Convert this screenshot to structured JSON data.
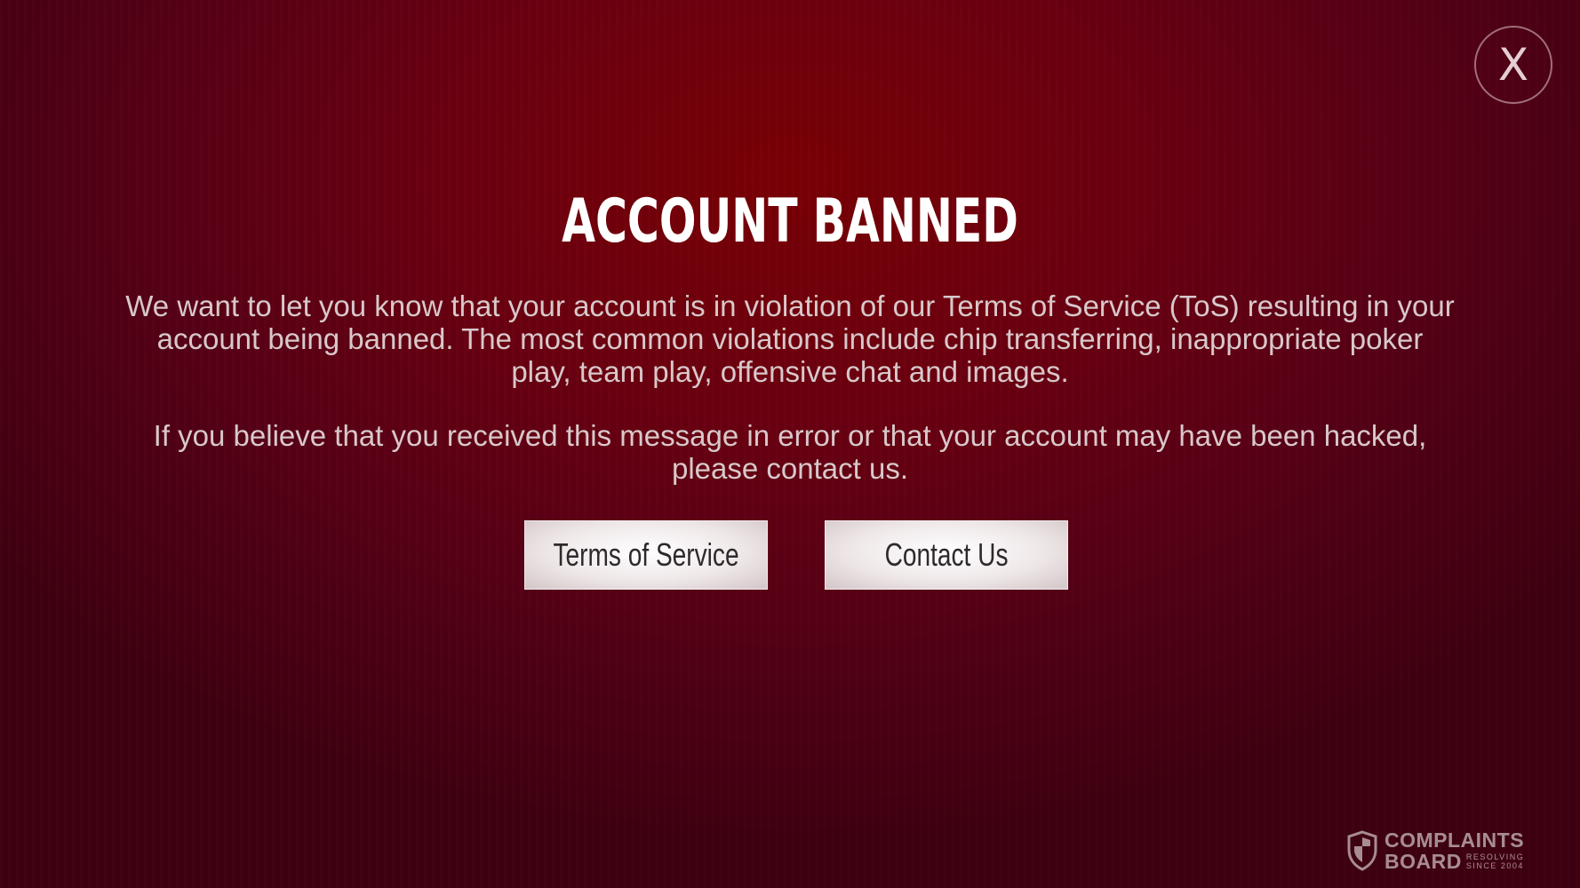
{
  "dialog": {
    "close_label": "X",
    "title": "ACCOUNT BANNED",
    "message_paragraph_1": "We want to let you know that your account is in violation of our Terms of Service (ToS) resulting in your account being banned. The most common violations include chip transferring, inappropriate poker play, team play, offensive chat and images.",
    "message_paragraph_2": "If you believe that you received this message in error or that your account may have been hacked, please contact us.",
    "buttons": {
      "terms_label": "Terms of Service",
      "contact_label": "Contact Us"
    }
  },
  "watermark": {
    "line1": "COMPLAINTS",
    "line2": "BOARD",
    "tagline_line1": "RESOLVING",
    "tagline_line2": "SINCE 2004",
    "icon": "shield-icon"
  },
  "colors": {
    "background": "#6a0010",
    "title_text": "#ffffff",
    "body_text": "#d8c8cb",
    "button_face": "#efe8e9",
    "button_text": "#2e2a2b"
  }
}
